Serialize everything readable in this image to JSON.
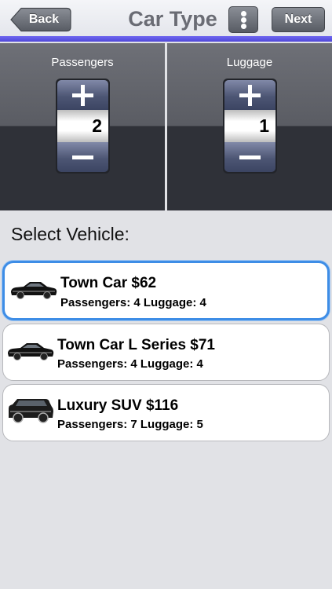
{
  "nav": {
    "back_label": "Back",
    "title": "Car Type",
    "next_label": "Next",
    "accent_color": "#5c55e6"
  },
  "steppers": [
    {
      "label": "Passengers",
      "value": "2"
    },
    {
      "label": "Luggage",
      "value": "1"
    }
  ],
  "section_label": "Select Vehicle:",
  "vehicles": [
    {
      "title": "Town Car $62",
      "details": "Passengers: 4 Luggage: 4",
      "selected": true,
      "icon": "sedan-icon"
    },
    {
      "title": "Town Car L Series $71",
      "details": "Passengers: 4 Luggage: 4",
      "selected": false,
      "icon": "sedan-icon"
    },
    {
      "title": "Luxury SUV $116",
      "details": "Passengers: 7 Luggage: 5",
      "selected": false,
      "icon": "suv-icon"
    }
  ],
  "colors": {
    "selected_border": "#3e8de6",
    "background": "#e1e2e6"
  }
}
